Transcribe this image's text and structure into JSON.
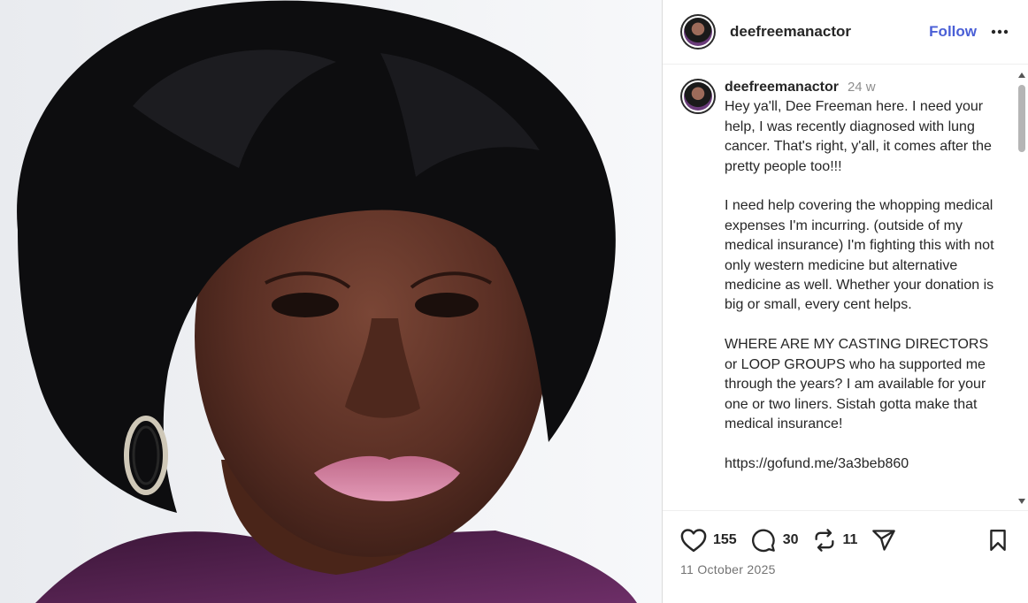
{
  "header": {
    "username": "deefreemanactor",
    "follow_label": "Follow",
    "more_icon": "more-horizontal-icon"
  },
  "caption": {
    "username": "deefreemanactor",
    "time": "24 w",
    "text": "Hey ya'll, Dee Freeman here. I need your help, I was recently diagnosed with lung cancer. That's right, y'all, it comes after the pretty people too!!!\n\nI need help covering the whopping medical expenses I'm incurring. (outside of my medical insurance) I'm fighting this with not only western medicine but alternative medicine as well. Whether your donation is big or small, every cent helps.\n\nWHERE ARE MY CASTING DIRECTORS or LOOP GROUPS who ha supported me through the years? I am available for your one or two liners. Sistah gotta make that medical insurance!\n\nhttps://gofund.me/3a3beb860"
  },
  "actions": {
    "likes": "155",
    "comments": "30",
    "reposts": "11",
    "icons": [
      "heart-icon",
      "comment-icon",
      "repost-icon",
      "share-icon",
      "bookmark-icon"
    ]
  },
  "date": "11 October 2025",
  "colors": {
    "accent": "#4a5fd6",
    "text": "#262626",
    "muted": "#737373"
  }
}
